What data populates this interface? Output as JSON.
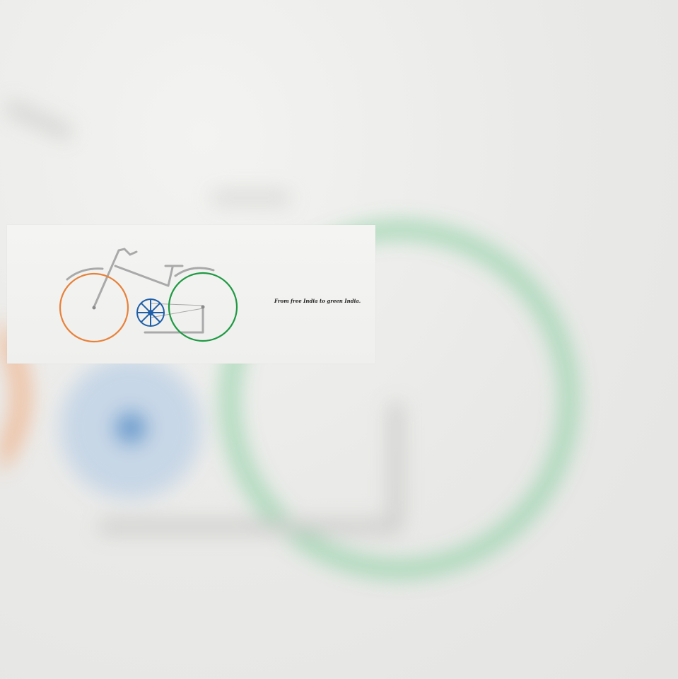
{
  "poster": {
    "tagline": "From free India to green India."
  },
  "colors": {
    "saffron": "#e8823a",
    "green": "#1f9a43",
    "chakra_blue": "#1f5fa8",
    "frame_gray": "#a9a9a9",
    "background": "#ececea"
  },
  "icons": {
    "bicycle": "bicycle-illustration",
    "chakra": "ashoka-chakra-icon"
  }
}
